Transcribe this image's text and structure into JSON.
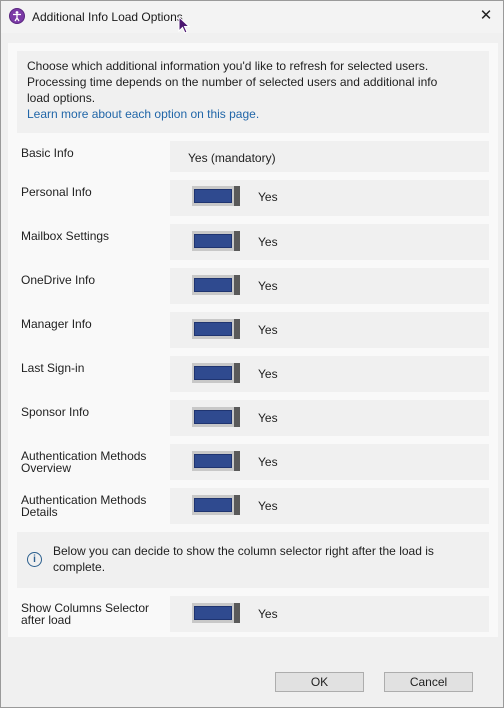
{
  "window": {
    "title": "Additional Info Load Options",
    "close_glyph": "✕",
    "app_icon": "accessibility-icon"
  },
  "intro": {
    "line1": "Choose which additional information you'd like to refresh for selected users.",
    "line2": "Processing time depends on the number of selected users and additional info",
    "line3": "load options.",
    "link": "Learn more about each option on this page."
  },
  "rows": {
    "basic": {
      "label": "Basic Info",
      "value": "Yes (mandatory)"
    },
    "personal": {
      "label": "Personal Info",
      "value": "Yes",
      "on": true
    },
    "mailbox": {
      "label": "Mailbox Settings",
      "value": "Yes",
      "on": true
    },
    "onedrive": {
      "label": "OneDrive Info",
      "value": "Yes",
      "on": true
    },
    "manager": {
      "label": "Manager Info",
      "value": "Yes",
      "on": true
    },
    "signin": {
      "label": "Last Sign-in",
      "value": "Yes",
      "on": true
    },
    "sponsor": {
      "label": "Sponsor Info",
      "value": "Yes",
      "on": true
    },
    "auth_overview": {
      "label_line1": "Authentication Methods",
      "label_line2": "Overview",
      "value": "Yes",
      "on": true
    },
    "auth_details": {
      "label_line1": "Authentication Methods",
      "label_line2": "Details",
      "value": "Yes",
      "on": true
    },
    "columns": {
      "label_line1": "Show Columns Selector",
      "label_line2": "after load",
      "value": "Yes",
      "on": true
    }
  },
  "info": {
    "icon": "info-icon",
    "line1": "Below you can decide to show the column selector right after the load is",
    "line2": "complete."
  },
  "buttons": {
    "ok": "OK",
    "cancel": "Cancel"
  },
  "colors": {
    "toggle_on": "#2f4a8f",
    "link": "#2166a8",
    "app_icon": "#7b3aa6"
  }
}
